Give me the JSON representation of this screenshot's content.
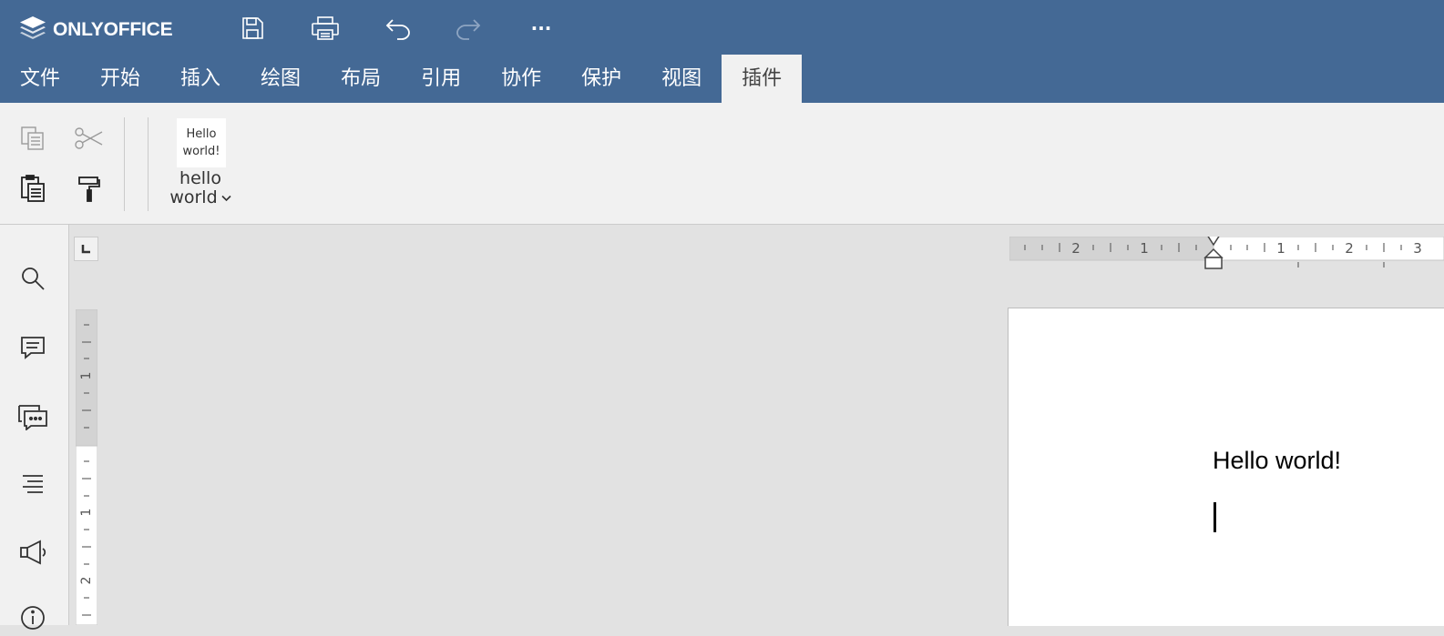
{
  "app": {
    "brand": "ONLYOFFICE"
  },
  "quick_access": {
    "icons": [
      "save-icon",
      "print-icon",
      "undo-icon",
      "redo-icon",
      "more-icon"
    ],
    "more_label": "···"
  },
  "tabs": [
    {
      "label": "文件"
    },
    {
      "label": "开始"
    },
    {
      "label": "插入"
    },
    {
      "label": "绘图"
    },
    {
      "label": "布局"
    },
    {
      "label": "引用"
    },
    {
      "label": "协作"
    },
    {
      "label": "保护"
    },
    {
      "label": "视图"
    },
    {
      "label": "插件",
      "active": true
    }
  ],
  "toolbar": {
    "clipboard_icons": [
      "copy-icon",
      "cut-icon",
      "paste-icon",
      "format-painter-icon"
    ],
    "plugin": {
      "thumb_line1": "Hello",
      "thumb_line2": "world!",
      "label_line1": "hello",
      "label_line2": "world"
    }
  },
  "sidebar": {
    "icons": [
      "search-icon",
      "comments-icon",
      "chat-icon",
      "navigation-icon",
      "feedback-icon",
      "about-icon"
    ]
  },
  "rulers": {
    "horizontal_labels": [
      "2",
      "1",
      "1",
      "2",
      "3"
    ],
    "vertical_labels": [
      "1",
      "1",
      "2"
    ]
  },
  "document": {
    "text": "Hello world!"
  },
  "colors": {
    "header": "#446995",
    "toolbar_bg": "#f1f1f1",
    "workspace_bg": "#e2e2e2"
  }
}
